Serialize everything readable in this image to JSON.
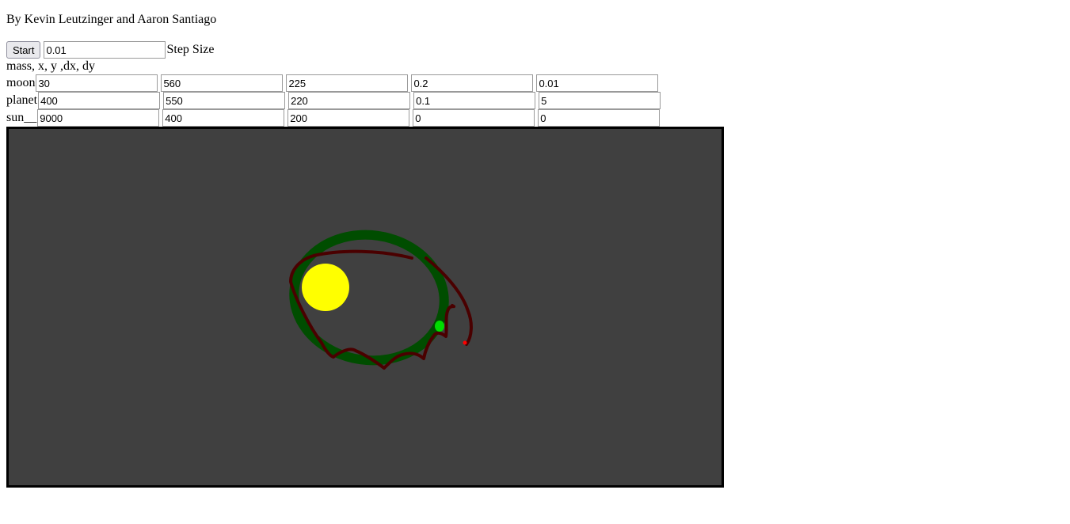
{
  "header": {
    "authors": "By Kevin Leutzinger and Aaron Santiago"
  },
  "controls": {
    "start_label": "Start",
    "step_size_value": "0.01",
    "step_size_label": "Step Size"
  },
  "table": {
    "header": "mass, x, y ,dx, dy",
    "bodies": [
      {
        "label": "moon",
        "values": [
          "30",
          "560",
          "225",
          "0.2",
          "0.01"
        ]
      },
      {
        "label": "planet",
        "values": [
          "400",
          "550",
          "220",
          "0.1",
          "5"
        ]
      },
      {
        "label": "sun__",
        "values": [
          "9000",
          "400",
          "200",
          "0",
          "0"
        ]
      }
    ]
  },
  "simulation": {
    "background_color": "#404040",
    "sun_color": "#ffff00",
    "planet_color": "#00dd00",
    "planet_orbit_color": "#004d00",
    "moon_color": "#ff0000",
    "moon_trail_color": "#4a0000"
  }
}
